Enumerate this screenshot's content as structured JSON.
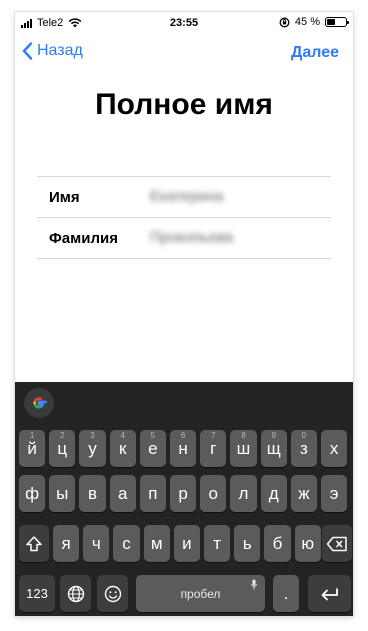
{
  "status_bar": {
    "carrier": "Tele2",
    "time": "23:55",
    "battery_percent": "45 %",
    "battery_level": 0.45
  },
  "nav": {
    "back_label": "Назад",
    "next_label": "Далее"
  },
  "page": {
    "title": "Полное имя"
  },
  "form": {
    "fields": [
      {
        "label": "Имя",
        "value": "Екатерина"
      },
      {
        "label": "Фамилия",
        "value": "Прокопьева"
      }
    ]
  },
  "keyboard": {
    "row1": [
      "й",
      "ц",
      "у",
      "к",
      "е",
      "н",
      "г",
      "ш",
      "щ",
      "з",
      "х"
    ],
    "row1_hints": [
      "1",
      "2",
      "3",
      "4",
      "5",
      "6",
      "7",
      "8",
      "9",
      "0",
      ""
    ],
    "row2": [
      "ф",
      "ы",
      "в",
      "а",
      "п",
      "р",
      "о",
      "л",
      "д",
      "ж",
      "э"
    ],
    "row3": [
      "я",
      "ч",
      "с",
      "м",
      "и",
      "т",
      "ь",
      "б",
      "ю"
    ],
    "numbers_label": "123",
    "space_label": "пробел",
    "period_label": ".",
    "shift_icon": "shift-icon",
    "backspace_icon": "backspace-icon",
    "globe_icon": "globe-icon",
    "emoji_icon": "emoji-icon",
    "return_icon": "return-icon",
    "google_icon": "google-icon"
  }
}
